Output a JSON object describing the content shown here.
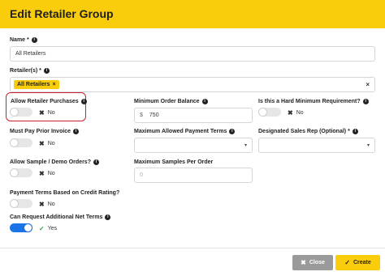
{
  "dialog": {
    "title": "Edit Retailer Group"
  },
  "fields": {
    "name": {
      "label": "Name *",
      "value": "All Retailers"
    },
    "retailers": {
      "label": "Retailer(s) *",
      "tag": "All Retailers",
      "tag_remove": "×",
      "clear": "×"
    },
    "allow_retailer_purchases": {
      "label": "Allow Retailer Purchases",
      "state": "No",
      "on": false
    },
    "minimum_order_balance": {
      "label": "Minimum Order Balance",
      "currency": "$",
      "value": "750"
    },
    "hard_minimum": {
      "label": "Is this a Hard Minimum Requirement?",
      "state": "No",
      "on": false
    },
    "must_pay_prior_invoice": {
      "label": "Must Pay Prior Invoice",
      "state": "No",
      "on": false
    },
    "max_payment_terms": {
      "label": "Maximum Allowed Payment Terms",
      "value": ""
    },
    "sales_rep": {
      "label": "Designated Sales Rep (Optional) *",
      "value": ""
    },
    "allow_sample_orders": {
      "label": "Allow Sample / Demo Orders?",
      "state": "No",
      "on": false
    },
    "max_samples": {
      "label": "Maximum Samples Per Order",
      "placeholder": "0"
    },
    "payment_terms_credit": {
      "label": "Payment Terms Based on Credit Rating?",
      "state": "No",
      "on": false
    },
    "additional_net_terms": {
      "label": "Can Request Additional Net Terms",
      "state": "Yes",
      "on": true
    }
  },
  "icons": {
    "info": "i",
    "off": "✖",
    "on": "✓",
    "caret": "▾",
    "close": "✖",
    "create": "✓"
  },
  "footer": {
    "close_label": "Close",
    "create_label": "Create"
  },
  "colors": {
    "brand": "#f9cd0b",
    "toggle_on": "#1b73e8",
    "highlight": "#d11f2b"
  }
}
